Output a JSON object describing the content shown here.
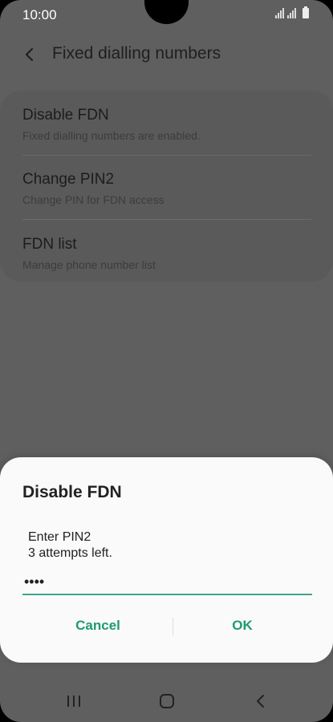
{
  "status_bar": {
    "time": "10:00"
  },
  "header": {
    "title": "Fixed dialling numbers"
  },
  "list": {
    "items": [
      {
        "label": "Disable FDN",
        "sub": "Fixed dialling numbers are enabled."
      },
      {
        "label": "Change PIN2",
        "sub": "Change PIN for FDN access"
      },
      {
        "label": "FDN list",
        "sub": "Manage phone number list"
      }
    ]
  },
  "dialog": {
    "title": "Disable FDN",
    "line1": "Enter PIN2",
    "line2": "3 attempts left.",
    "pin_value": "••••",
    "cancel_label": "Cancel",
    "ok_label": "OK"
  },
  "colors": {
    "accent": "#1f9a73",
    "input_underline": "#3fa48a",
    "scrim_background": "#5f5f5f",
    "dialog_background": "#fafafa"
  },
  "icons": {
    "back": "back-arrow-icon",
    "signal": "signal-icon",
    "battery": "battery-icon",
    "nav_recent": "recent-apps-icon",
    "nav_home": "home-icon",
    "nav_back": "back-icon"
  }
}
